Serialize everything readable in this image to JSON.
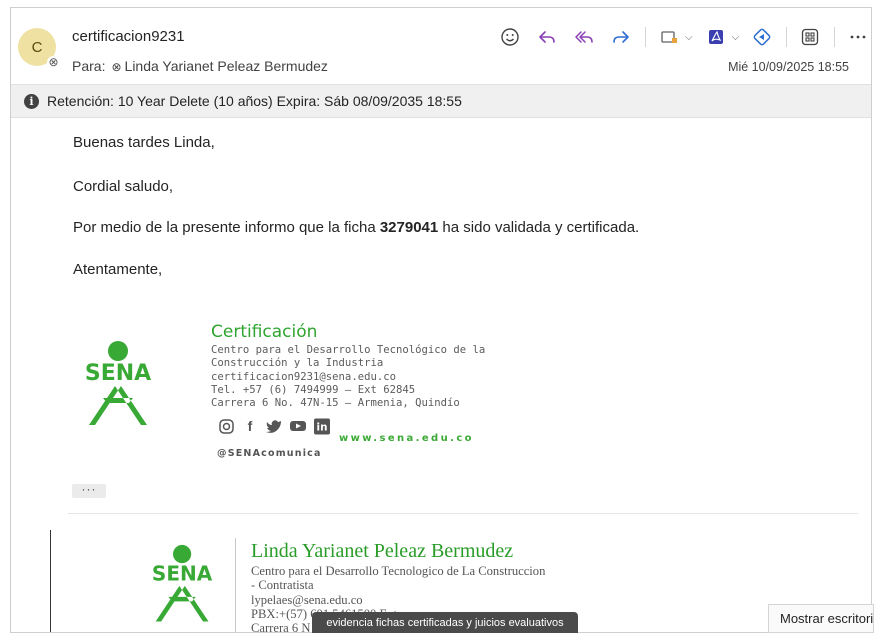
{
  "header": {
    "avatar_initial": "C",
    "sender": "certificacion9231",
    "to_label": "Para:",
    "recipient": "Linda Yarianet Peleaz Bermudez",
    "date": "Mié 10/09/2025 18:55",
    "toolbar_icons": [
      "emoji-icon",
      "reply-icon",
      "reply-all-icon",
      "forward-icon",
      "apps-icon",
      "pdf-icon",
      "immersive-reader-icon",
      "grid-icon",
      "more-icon"
    ]
  },
  "retention": {
    "text": "Retención: 10 Year Delete (10 años) Expira: Sáb 08/09/2035 18:55"
  },
  "body": {
    "greeting": "Buenas tardes Linda,",
    "salutation": "Cordial saludo,",
    "message_before": "Por medio de la presente informo que la ficha ",
    "ficha_number": "3279041",
    "message_after": " ha sido validada y certificada.",
    "closing": "Atentamente,"
  },
  "signature1": {
    "logo_text": "SENA",
    "title": "Certificación",
    "lines": [
      "Centro para el Desarrollo Tecnológico de la",
      "Construcción y la Industria",
      "certificacion9231@sena.edu.co",
      "Tel. +57 (6) 7494999 – Ext 62845",
      "Carrera 6 No. 47N-15 – Armenia, Quindío"
    ],
    "website": "www.sena.edu.co",
    "handle": "@SENAcomunica",
    "social_icons": [
      "instagram-icon",
      "facebook-icon",
      "twitter-icon",
      "youtube-icon",
      "linkedin-icon"
    ]
  },
  "more_button": "···",
  "signature2": {
    "logo_text": "SENA",
    "name": "Linda Yarianet Peleaz Bermudez",
    "lines": [
      "Centro para el Desarrollo Tecnologico de La Construccion",
      "- Contratista",
      "lypelaes@sena.edu.co",
      "PBX:+(57) 601 5461500 Ext:",
      "Carrera 6 N"
    ]
  },
  "tooltip": "evidencia fichas certificadas y juicios evaluativos",
  "show_desktop": "Mostrar escritorio",
  "colors": {
    "sena_green": "#39a935",
    "accent_purple": "#8a3fb5",
    "pdf_blue": "#3b3fb0"
  }
}
